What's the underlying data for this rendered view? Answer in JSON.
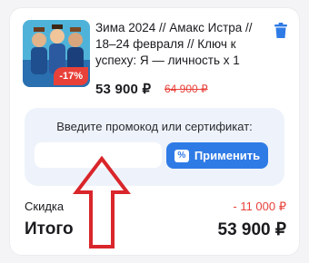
{
  "product": {
    "title": "Зима 2024 // Амакс Истра // 18–24 февраля // Ключ к успеху: Я — личность х 1",
    "discount_badge": "-17%",
    "price": "53 900 ₽",
    "old_price": "64 900 ₽",
    "delete_icon": "trash-icon"
  },
  "promo": {
    "label": "Введите промокод или сертификат:",
    "input_value": "",
    "apply_label": "Применить",
    "apply_icon": "percent-coupon-icon"
  },
  "summary": {
    "discount_label": "Скидка",
    "discount_value": "- 11 000 ₽",
    "total_label": "Итого",
    "total_value": "53 900 ₽"
  },
  "colors": {
    "accent_blue": "#2f7be6",
    "discount_red": "#e8413a",
    "arrow_red": "#d9262b"
  }
}
